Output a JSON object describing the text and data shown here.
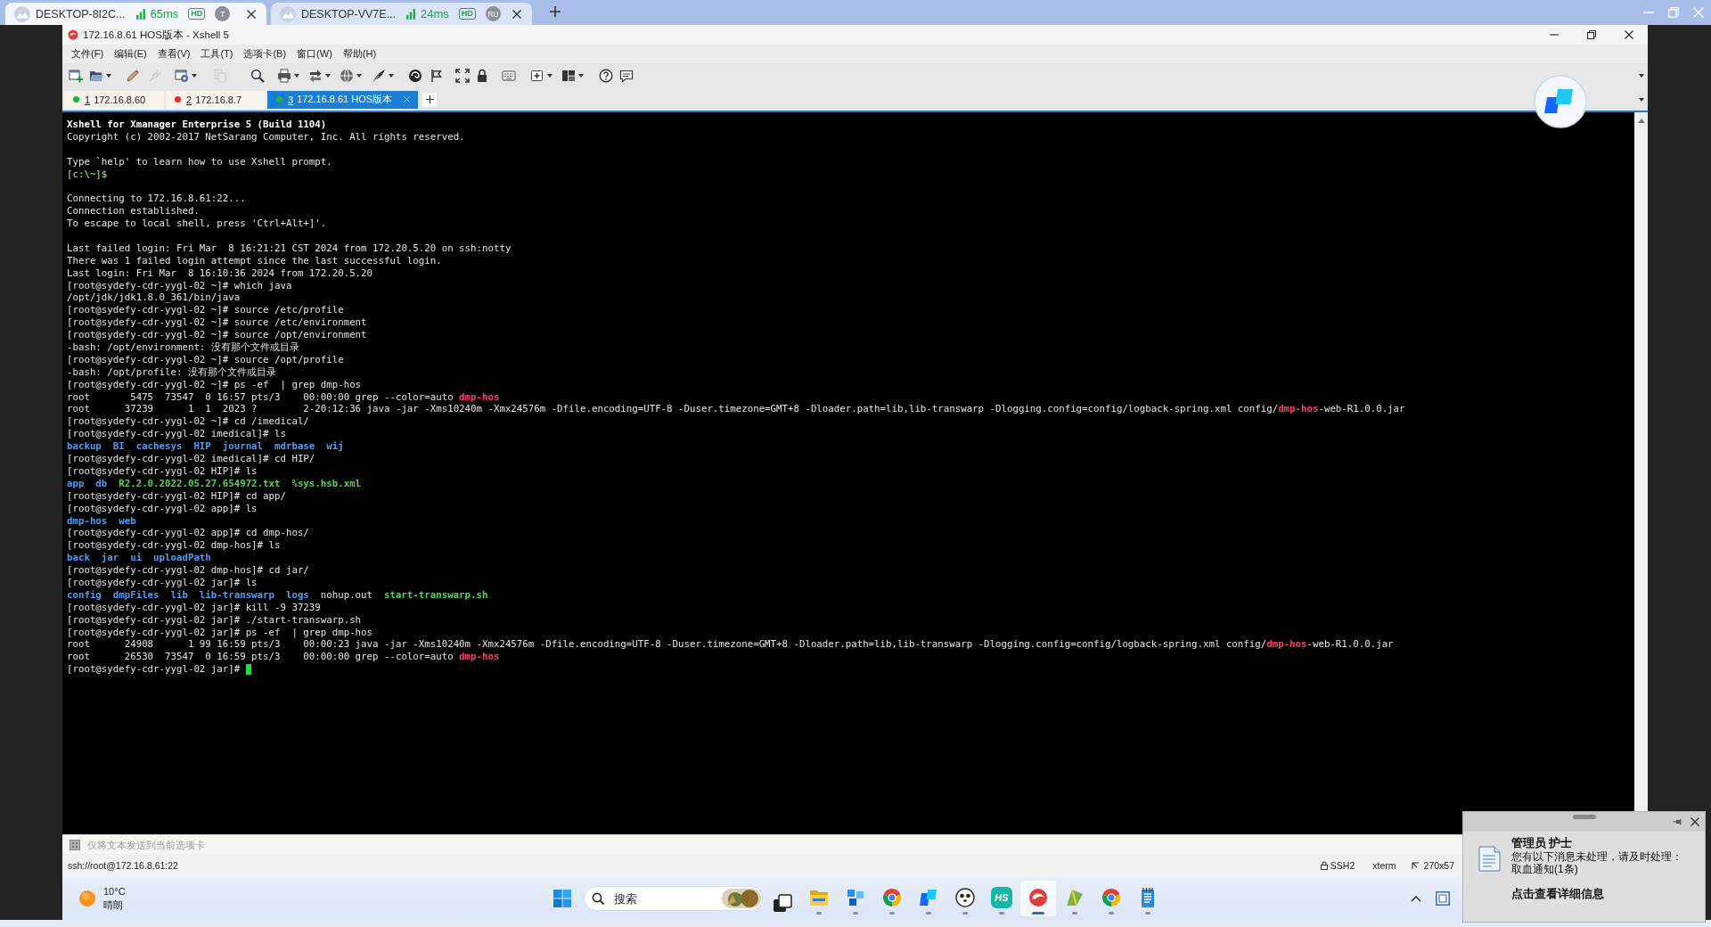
{
  "remote_tabs": [
    {
      "title": "DESKTOP-8I2C...",
      "latency": "65ms",
      "quality": "HD",
      "user": "T",
      "selected": true
    },
    {
      "title": "DESKTOP-VV7E...",
      "latency": "24ms",
      "quality": "HD",
      "user": "RU",
      "selected": false
    }
  ],
  "window": {
    "title": "172.16.8.61 HOS版本 - Xshell 5"
  },
  "menu": [
    "文件(F)",
    "编辑(E)",
    "查看(V)",
    "工具(T)",
    "选项卡(B)",
    "窗口(W)",
    "帮助(H)"
  ],
  "toolbar": [
    {
      "dropdown": false,
      "disabled": false
    },
    {
      "dropdown": true,
      "disabled": false
    },
    {
      "dropdown": false,
      "disabled": false
    },
    {
      "dropdown": false,
      "disabled": true
    },
    {
      "dropdown": true,
      "disabled": false
    },
    {
      "dropdown": false,
      "disabled": true
    },
    {
      "dropdown": false,
      "disabled": false
    },
    {
      "dropdown": true,
      "disabled": false
    },
    {
      "dropdown": true,
      "disabled": false
    },
    {
      "dropdown": true,
      "disabled": false
    },
    {
      "dropdown": true,
      "disabled": false
    },
    {
      "dropdown": false,
      "disabled": false
    },
    {
      "dropdown": false,
      "disabled": false
    },
    {
      "dropdown": false,
      "disabled": false
    },
    {
      "dropdown": false,
      "disabled": false
    },
    {
      "dropdown": false,
      "disabled": false
    },
    {
      "dropdown": true,
      "disabled": false
    },
    {
      "dropdown": true,
      "disabled": false
    },
    {
      "dropdown": false,
      "disabled": false
    },
    {
      "dropdown": false,
      "disabled": false
    }
  ],
  "session_tabs": [
    {
      "number": "1",
      "label": "172.16.8.60",
      "color": "#1fb141",
      "selected": false
    },
    {
      "number": "2",
      "label": "172.16.8.7",
      "color": "#e8282c",
      "selected": false
    },
    {
      "number": "3",
      "label": "172.16.8.61 HOS版本",
      "color": "#1fb141",
      "selected": true
    }
  ],
  "terminal": {
    "blocks": [
      {
        "lines": [
          {
            "kind": "banner",
            "text": "Xshell for Xmanager Enterprise 5 (Build 1104)"
          },
          {
            "kind": "text",
            "text": "Copyright (c) 2002-2017 NetSarang Computer, Inc. All rights reserved."
          }
        ]
      },
      {
        "lines": [
          {
            "kind": "text",
            "text": "Type `help' to learn how to use Xshell prompt."
          },
          {
            "kind": "local",
            "text": "[c:\\~]$"
          }
        ]
      },
      {
        "lines": [
          {
            "kind": "text",
            "text": "Connecting to 172.16.8.61:22..."
          },
          {
            "kind": "text",
            "text": "Connection established."
          },
          {
            "kind": "text",
            "text": "To escape to local shell, press 'Ctrl+Alt+]'."
          }
        ]
      },
      {
        "lines": [
          {
            "kind": "text",
            "text": "Last failed login: Fri Mar  8 16:21:21 CST 2024 from 172.20.5.20 on ssh:notty"
          },
          {
            "kind": "text",
            "text": "There was 1 failed login attempt since the last successful login."
          },
          {
            "kind": "text",
            "text": "Last login: Fri Mar  8 16:10:36 2024 from 172.20.5.20"
          },
          {
            "kind": "text",
            "text": "[root@sydefy-cdr-yygl-02 ~]# which java"
          },
          {
            "kind": "text",
            "text": "/opt/jdk/jdk1.8.0_361/bin/java"
          },
          {
            "kind": "text",
            "text": "[root@sydefy-cdr-yygl-02 ~]# source /etc/profile"
          },
          {
            "kind": "text",
            "text": "[root@sydefy-cdr-yygl-02 ~]# source /etc/environment"
          },
          {
            "kind": "text",
            "text": "[root@sydefy-cdr-yygl-02 ~]# source /opt/environment"
          },
          {
            "kind": "text",
            "text": "-bash: /opt/environment: 没有那个文件或目录"
          },
          {
            "kind": "text",
            "text": "[root@sydefy-cdr-yygl-02 ~]# source /opt/profile"
          },
          {
            "kind": "text",
            "text": "-bash: /opt/profile: 没有那个文件或目录"
          },
          {
            "kind": "text",
            "text": "[root@sydefy-cdr-yygl-02 ~]# ps -ef  | grep dmp-hos"
          },
          {
            "kind": "mixed",
            "segments": [
              {
                "kind": "text",
                "text": "root       5475  73547  0 16:57 pts/3    00:00:00 grep --color=auto "
              },
              {
                "kind": "match",
                "text": "dmp-hos"
              }
            ]
          },
          {
            "kind": "mixed",
            "segments": [
              {
                "kind": "text",
                "text": "root      37239      1  1  2023 ?        2-20:12:36 java -jar -Xms10240m -Xmx24576m -Dfile.encoding=UTF-8 -Duser.timezone=GMT+8 -Dloader.path=lib,lib-transwarp -Dlogging.config=config/logback-spring.xml config/"
              },
              {
                "kind": "match",
                "text": "dmp-hos"
              },
              {
                "kind": "text",
                "text": "-web-R1.0.0.jar"
              }
            ]
          },
          {
            "kind": "text",
            "text": "[root@sydefy-cdr-yygl-02 ~]# cd /imedical/"
          },
          {
            "kind": "text",
            "text": "[root@sydefy-cdr-yygl-02 imedical]# ls"
          },
          {
            "kind": "listing",
            "entries": [
              {
                "kind": "dir",
                "text": "backup"
              },
              {
                "kind": "dir",
                "text": "BI"
              },
              {
                "kind": "dir",
                "text": "cachesys"
              },
              {
                "kind": "dir",
                "text": "HIP"
              },
              {
                "kind": "dir",
                "text": "journal"
              },
              {
                "kind": "dir",
                "text": "mdrbase"
              },
              {
                "kind": "dir",
                "text": "wij"
              }
            ]
          },
          {
            "kind": "text",
            "text": "[root@sydefy-cdr-yygl-02 imedical]# cd HIP/"
          },
          {
            "kind": "text",
            "text": "[root@sydefy-cdr-yygl-02 HIP]# ls"
          },
          {
            "kind": "listing",
            "entries": [
              {
                "kind": "dir",
                "text": "app"
              },
              {
                "kind": "dir",
                "text": "db"
              },
              {
                "kind": "exec",
                "text": "R2.2.0.2022.05.27.654972.txt"
              },
              {
                "kind": "exec",
                "text": "%sys.hsb.xml"
              }
            ]
          },
          {
            "kind": "text",
            "text": "[root@sydefy-cdr-yygl-02 HIP]# cd app/"
          },
          {
            "kind": "text",
            "text": "[root@sydefy-cdr-yygl-02 app]# ls"
          },
          {
            "kind": "listing",
            "entries": [
              {
                "kind": "dir",
                "text": "dmp-hos"
              },
              {
                "kind": "dir",
                "text": "web"
              }
            ]
          },
          {
            "kind": "text",
            "text": "[root@sydefy-cdr-yygl-02 app]# cd dmp-hos/"
          },
          {
            "kind": "text",
            "text": "[root@sydefy-cdr-yygl-02 dmp-hos]# ls"
          },
          {
            "kind": "listing",
            "entries": [
              {
                "kind": "dir",
                "text": "back"
              },
              {
                "kind": "dir",
                "text": "jar"
              },
              {
                "kind": "dir",
                "text": "ui"
              },
              {
                "kind": "dir",
                "text": "uploadPath"
              }
            ]
          },
          {
            "kind": "text",
            "text": "[root@sydefy-cdr-yygl-02 dmp-hos]# cd jar/"
          },
          {
            "kind": "text",
            "text": "[root@sydefy-cdr-yygl-02 jar]# ls"
          },
          {
            "kind": "listing",
            "entries": [
              {
                "kind": "dir",
                "text": "config"
              },
              {
                "kind": "dir",
                "text": "dmpFiles"
              },
              {
                "kind": "dir",
                "text": "lib"
              },
              {
                "kind": "dir",
                "text": "lib-transwarp"
              },
              {
                "kind": "dir",
                "text": "logs"
              },
              {
                "kind": "file",
                "text": "nohup.out"
              },
              {
                "kind": "exec",
                "text": "start-transwarp.sh"
              }
            ]
          },
          {
            "kind": "text",
            "text": "[root@sydefy-cdr-yygl-02 jar]# kill -9 37239"
          },
          {
            "kind": "text",
            "text": "[root@sydefy-cdr-yygl-02 jar]# ./start-transwarp.sh"
          },
          {
            "kind": "text",
            "text": "[root@sydefy-cdr-yygl-02 jar]# ps -ef  | grep dmp-hos"
          },
          {
            "kind": "mixed",
            "segments": [
              {
                "kind": "text",
                "text": "root      24908      1 99 16:59 pts/3    00:00:23 java -jar -Xms10240m -Xmx24576m -Dfile.encoding=UTF-8 -Duser.timezone=GMT+8 -Dloader.path=lib,lib-transwarp -Dlogging.config=config/logback-spring.xml config/"
              },
              {
                "kind": "match",
                "text": "dmp-hos"
              },
              {
                "kind": "text",
                "text": "-web-R1.0.0.jar"
              }
            ]
          },
          {
            "kind": "mixed",
            "segments": [
              {
                "kind": "text",
                "text": "root      26530  73547  0 16:59 pts/3    00:00:00 grep --color=auto "
              },
              {
                "kind": "match",
                "text": "dmp-hos"
              }
            ]
          },
          {
            "kind": "text",
            "text": "[root@sydefy-cdr-yygl-02 jar]#"
          }
        ]
      }
    ],
    "cursor": true
  },
  "compose_bar": {
    "placeholder": "仅将文本发送到当前选项卡"
  },
  "status_bar": {
    "address": "ssh://root@172.16.8.61:22",
    "protocol": "SSH2",
    "terminal_type": "xterm",
    "size": "270x57"
  },
  "taskbar": {
    "weather": {
      "temperature": "10°C",
      "condition": "晴朗"
    },
    "search": {
      "placeholder": "搜索"
    },
    "apps": [
      {
        "running": false,
        "active": false
      },
      {
        "running": true,
        "active": false
      },
      {
        "running": true,
        "active": false
      },
      {
        "running": true,
        "active": false
      },
      {
        "running": true,
        "active": false
      },
      {
        "running": true,
        "active": false
      },
      {
        "text": "HS",
        "running": true,
        "active": false
      },
      {
        "running": true,
        "active": true
      },
      {
        "running": true,
        "active": false
      },
      {
        "running": true,
        "active": false
      },
      {
        "running": true,
        "active": false
      }
    ]
  },
  "notification": {
    "sender": "管理员 护士",
    "message": "您有以下消息未处理，请及时处理：",
    "detail": "取血通知(1条)",
    "link": "点击查看详细信息"
  }
}
